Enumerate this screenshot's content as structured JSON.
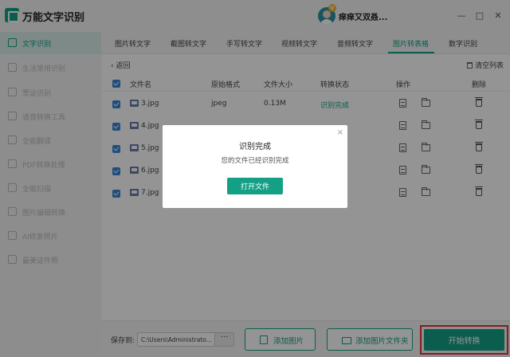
{
  "app": {
    "title": "万能文字识别",
    "username": "痒痒又双叒...",
    "vip_badge": "V"
  },
  "window_controls": {
    "minimize": "—",
    "maximize": "□",
    "close": "✕"
  },
  "sidebar": {
    "items": [
      {
        "label": "文字识别",
        "icon": "text-scan-icon",
        "active": true
      },
      {
        "label": "生活常用识别",
        "icon": "life-icon",
        "active": false
      },
      {
        "label": "票证识别",
        "icon": "ticket-icon",
        "active": false
      },
      {
        "label": "语音转换工具",
        "icon": "voice-icon",
        "active": false
      },
      {
        "label": "全能翻译",
        "icon": "translate-icon",
        "active": false
      },
      {
        "label": "PDF转换处理",
        "icon": "pdf-icon",
        "active": false
      },
      {
        "label": "全能扫描",
        "icon": "scan-icon",
        "active": false
      },
      {
        "label": "图片编辑转换",
        "icon": "image-edit-icon",
        "active": false
      },
      {
        "label": "AI修复照片",
        "icon": "ai-repair-icon",
        "active": false
      },
      {
        "label": "最美证件照",
        "icon": "id-photo-icon",
        "active": false
      }
    ]
  },
  "tabs": [
    {
      "label": "图片转文字",
      "active": false
    },
    {
      "label": "截图转文字",
      "active": false
    },
    {
      "label": "手写转文字",
      "active": false
    },
    {
      "label": "视频转文字",
      "active": false
    },
    {
      "label": "音频转文字",
      "active": false
    },
    {
      "label": "图片转表格",
      "active": true
    },
    {
      "label": "数字识别",
      "active": false
    }
  ],
  "toolbar": {
    "back": "‹ 返回",
    "clear": "清空列表"
  },
  "table": {
    "headers": {
      "name": "文件名",
      "format": "原始格式",
      "size": "文件大小",
      "status": "转换状态",
      "action": "操作",
      "delete": "删除"
    },
    "rows": [
      {
        "name": "3.jpg",
        "format": "jpeg",
        "size": "0.13M",
        "status": "识别完成"
      },
      {
        "name": "4.jpg",
        "format": "",
        "size": "",
        "status": ""
      },
      {
        "name": "5.jpg",
        "format": "",
        "size": "",
        "status": ""
      },
      {
        "name": "6.jpg",
        "format": "",
        "size": "",
        "status": ""
      },
      {
        "name": "7.jpg",
        "format": "",
        "size": "",
        "status": ""
      }
    ]
  },
  "bottom": {
    "save_label": "保存到:",
    "save_path": "C:\\Users\\Administrato...",
    "browse": "···",
    "add_image": "添加图片",
    "add_folder": "添加图片文件夹",
    "start": "开始转换"
  },
  "modal": {
    "close": "×",
    "title": "识别完成",
    "message": "您的文件已经识别完成",
    "button": "打开文件"
  },
  "colors": {
    "accent": "#14a085",
    "checkbox": "#3a86d6",
    "highlight_frame": "#e03434"
  }
}
